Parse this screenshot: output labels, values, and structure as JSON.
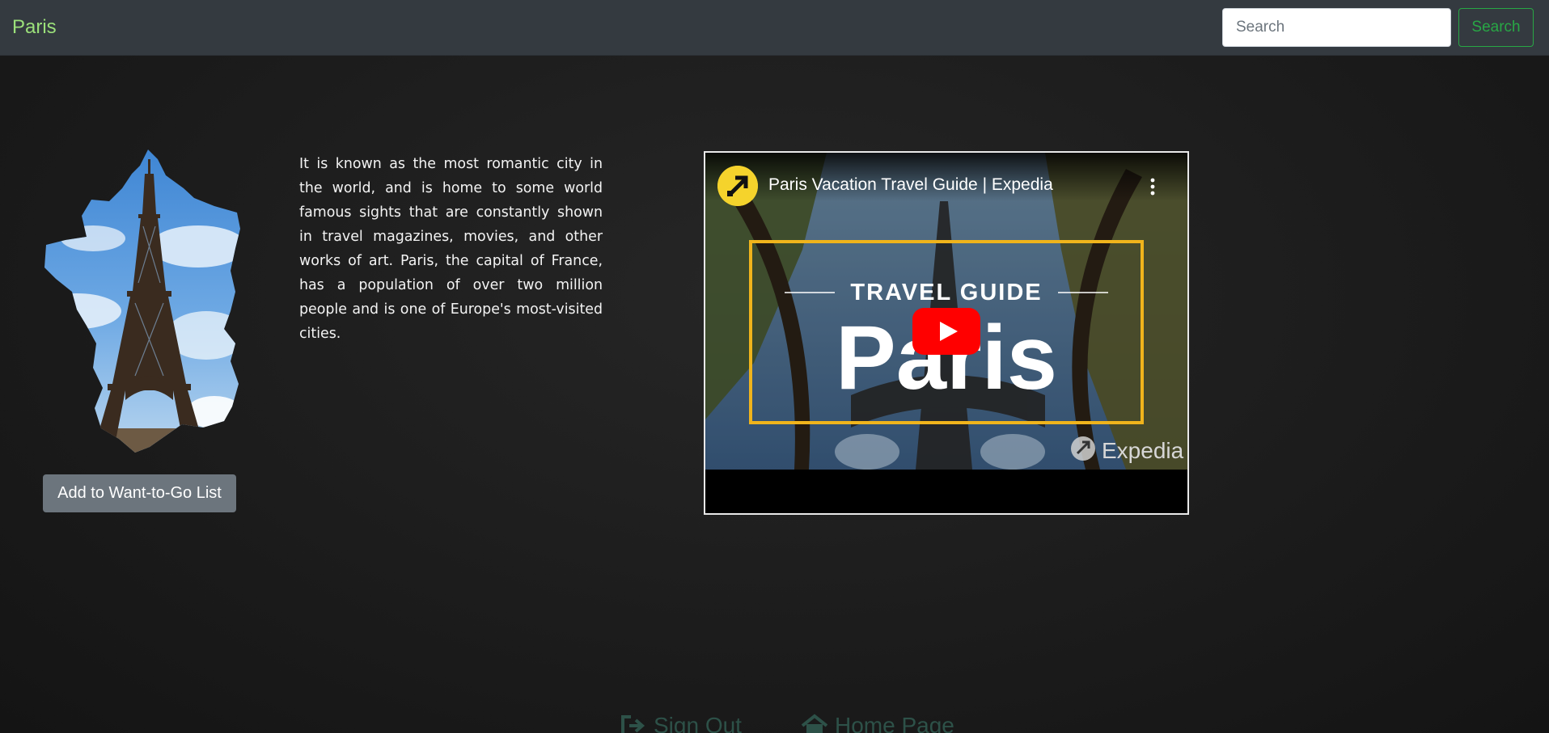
{
  "navbar": {
    "brand": "Paris",
    "search": {
      "placeholder": "Search",
      "value": ""
    },
    "search_button_label": "Search"
  },
  "sidebar": {
    "image_icon": "france-map-eiffel-tower-image",
    "add_button_label": "Add to Want-to-Go List"
  },
  "content": {
    "description": "It is known as the most romantic city in the world, and is home to some world famous sights that are constantly shown in travel magazines, movies, and other works of art. Paris, the capital of France, has a population of over two million people and is one of Europe's most-visited cities."
  },
  "video": {
    "title": "Paris Vacation Travel Guide | Expedia",
    "thumbnail_heading": "TRAVEL GUIDE",
    "thumbnail_city": "Paris",
    "watermark": "Expedia",
    "icons": [
      "channel-logo-icon",
      "more-options-icon",
      "youtube-play-icon"
    ]
  },
  "footer": {
    "sign_out_label": "Sign Out",
    "home_label": "Home Page",
    "icons": [
      "sign-out-icon",
      "home-icon"
    ]
  },
  "colors": {
    "navbar_bg": "#343a40",
    "brand": "#9be07a",
    "success": "#28a745",
    "secondary": "#6c757d",
    "thumbnail_frame": "#f0b41c",
    "youtube_red": "#ff0000",
    "footer_link": "#2d5148"
  }
}
